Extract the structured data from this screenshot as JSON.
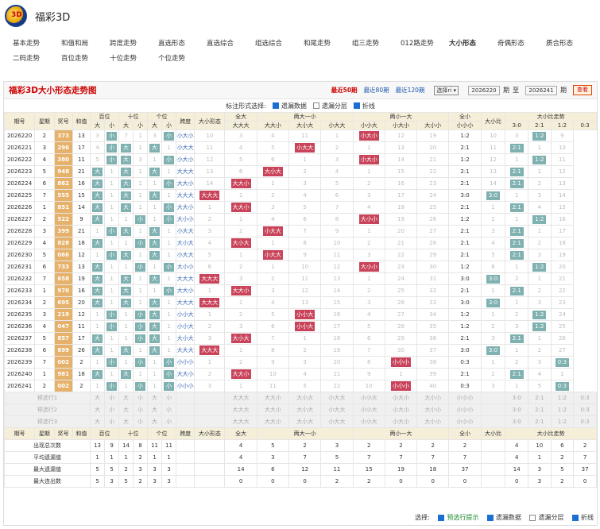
{
  "site": {
    "title": "福彩3D"
  },
  "nav": [
    "基本走势",
    "和值和局",
    "跨度走势",
    "直选形态",
    "直选综合",
    "组选综合",
    "和尾走势",
    "组三走势",
    "012路走势",
    "大小形态",
    "奇偶形态",
    "质合形态",
    "二码走势",
    "百位走势",
    "十位走势",
    "个位走势"
  ],
  "panel": {
    "title": "福彩3D大小形态走势图",
    "recent50": "最近50期",
    "recent80": "最近80期",
    "recent120": "最近120期",
    "select": "选择ri",
    "from": "2026220",
    "to_label": "至",
    "to": "2026241",
    "period": "期",
    "query": "查看"
  },
  "options": {
    "label": "标注形式选择:",
    "o1": "遗漏数据",
    "o2": "遗漏分层",
    "o3": "折线"
  },
  "head1": [
    "期号",
    "星期",
    "奖号",
    "和值",
    "百位",
    "十位",
    "个位",
    "跨度",
    "大小形态",
    "全大",
    "两大一小",
    "两小一大",
    "全小",
    "大小比",
    "大小比走势"
  ],
  "head2": [
    "大",
    "小",
    "大",
    "小",
    "大",
    "小",
    "大大大",
    "大大小",
    "大小大",
    "小大大",
    "小小大",
    "小大小",
    "大小小",
    "小小小",
    "3:0",
    "2:1",
    "1:2",
    "0:3"
  ],
  "rows": [
    [
      "2026220",
      "2",
      "373",
      "13",
      "3",
      "小",
      "7",
      "1",
      "3",
      "小",
      "小大小",
      "10",
      "3",
      "4",
      "11",
      "1",
      "小大小",
      "12",
      "19",
      "1:2",
      "10",
      "3",
      "1:2",
      "9"
    ],
    [
      "2026221",
      "3",
      "296",
      "17",
      "4",
      "小",
      "大",
      "1",
      "大",
      "1",
      "小大大",
      "11",
      "4",
      "5",
      "小大大",
      "2",
      "1",
      "13",
      "20",
      "2:1",
      "11",
      "2:1",
      "1",
      "10"
    ],
    [
      "2026222",
      "4",
      "380",
      "11",
      "5",
      "小",
      "大",
      "3",
      "1",
      "小",
      "小大小",
      "12",
      "5",
      "6",
      "1",
      "3",
      "小大小",
      "14",
      "21",
      "1:2",
      "12",
      "1",
      "1:2",
      "11"
    ],
    [
      "2026223",
      "5",
      "948",
      "21",
      "大",
      "1",
      "大",
      "1",
      "大",
      "1",
      "大大大",
      "13",
      "6",
      "大小大",
      "2",
      "4",
      "1",
      "15",
      "22",
      "2:1",
      "13",
      "2:1",
      "1",
      "12"
    ],
    [
      "2026224",
      "6",
      "862",
      "16",
      "大",
      "1",
      "大",
      "1",
      "1",
      "小",
      "大大小",
      "14",
      "大大小",
      "1",
      "3",
      "5",
      "2",
      "16",
      "23",
      "2:1",
      "14",
      "2:1",
      "2",
      "13"
    ],
    [
      "2026225",
      "7",
      "555",
      "15",
      "大",
      "1",
      "大",
      "1",
      "大",
      "1",
      "大大大",
      "大大大",
      "1",
      "2",
      "4",
      "6",
      "3",
      "17",
      "24",
      "3:0",
      "3:0",
      "1",
      "3",
      "14"
    ],
    [
      "2026226",
      "1",
      "851",
      "14",
      "大",
      "1",
      "大",
      "1",
      "1",
      "小",
      "大大小",
      "1",
      "大大小",
      "3",
      "5",
      "7",
      "4",
      "18",
      "25",
      "2:1",
      "1",
      "2:1",
      "4",
      "15"
    ],
    [
      "2026227",
      "2",
      "522",
      "9",
      "大",
      "1",
      "1",
      "小",
      "1",
      "小",
      "大小小",
      "2",
      "1",
      "4",
      "6",
      "8",
      "大小小",
      "19",
      "26",
      "1:2",
      "2",
      "1",
      "1:2",
      "16"
    ],
    [
      "2026228",
      "3",
      "399",
      "21",
      "1",
      "小",
      "大",
      "1",
      "大",
      "1",
      "小大大",
      "3",
      "2",
      "小大大",
      "7",
      "9",
      "1",
      "20",
      "27",
      "2:1",
      "3",
      "2:1",
      "1",
      "17"
    ],
    [
      "2026229",
      "4",
      "828",
      "18",
      "大",
      "1",
      "1",
      "小",
      "大",
      "1",
      "大小大",
      "4",
      "大小大",
      "1",
      "8",
      "10",
      "2",
      "21",
      "28",
      "2:1",
      "4",
      "2:1",
      "2",
      "18"
    ],
    [
      "2026230",
      "5",
      "066",
      "12",
      "1",
      "小",
      "大",
      "1",
      "大",
      "1",
      "小大大",
      "5",
      "1",
      "小大大",
      "9",
      "11",
      "3",
      "22",
      "29",
      "2:1",
      "5",
      "2:1",
      "3",
      "19"
    ],
    [
      "2026231",
      "6",
      "733",
      "13",
      "大",
      "1",
      "1",
      "小",
      "1",
      "小",
      "大小小",
      "6",
      "2",
      "1",
      "10",
      "12",
      "大小小",
      "23",
      "30",
      "1:2",
      "6",
      "1",
      "1:2",
      "20"
    ],
    [
      "2026232",
      "7",
      "658",
      "19",
      "大",
      "1",
      "大",
      "1",
      "大",
      "1",
      "大大大",
      "大大大",
      "3",
      "2",
      "11",
      "13",
      "1",
      "24",
      "31",
      "3:0",
      "3:0",
      "2",
      "1",
      "21"
    ],
    [
      "2026233",
      "1",
      "970",
      "16",
      "大",
      "1",
      "大",
      "1",
      "1",
      "小",
      "大大小",
      "1",
      "大大小",
      "3",
      "12",
      "14",
      "2",
      "25",
      "32",
      "2:1",
      "1",
      "2:1",
      "2",
      "22"
    ],
    [
      "2026234",
      "2",
      "695",
      "20",
      "大",
      "1",
      "大",
      "1",
      "大",
      "1",
      "大大大",
      "大大大",
      "1",
      "4",
      "13",
      "15",
      "3",
      "26",
      "33",
      "3:0",
      "3:0",
      "1",
      "3",
      "23"
    ],
    [
      "2026235",
      "3",
      "219",
      "12",
      "1",
      "小",
      "1",
      "小",
      "大",
      "1",
      "小小大",
      "1",
      "2",
      "5",
      "小小大",
      "16",
      "4",
      "27",
      "34",
      "1:2",
      "1",
      "2",
      "1:2",
      "24"
    ],
    [
      "2026236",
      "4",
      "047",
      "11",
      "1",
      "小",
      "1",
      "小",
      "大",
      "1",
      "小小大",
      "2",
      "3",
      "6",
      "小小大",
      "17",
      "5",
      "28",
      "35",
      "1:2",
      "2",
      "3",
      "1:2",
      "25"
    ],
    [
      "2026237",
      "5",
      "857",
      "17",
      "大",
      "1",
      "1",
      "小",
      "大",
      "1",
      "大小大",
      "3",
      "大小大",
      "7",
      "1",
      "18",
      "6",
      "29",
      "36",
      "2:1",
      "3",
      "2:1",
      "1",
      "26"
    ],
    [
      "2026238",
      "6",
      "899",
      "26",
      "大",
      "1",
      "大",
      "1",
      "大",
      "1",
      "大大大",
      "大大大",
      "1",
      "8",
      "2",
      "19",
      "7",
      "30",
      "37",
      "3:0",
      "3:0",
      "1",
      "2",
      "27"
    ],
    [
      "2026239",
      "7",
      "002",
      "2",
      "1",
      "小",
      "1",
      "小",
      "1",
      "小",
      "小小小",
      "1",
      "2",
      "9",
      "3",
      "20",
      "8",
      "小小小",
      "38",
      "0:3",
      "1",
      "2",
      "3",
      "0:3"
    ],
    [
      "2026240",
      "1",
      "981",
      "18",
      "大",
      "1",
      "大",
      "1",
      "1",
      "小",
      "大大小",
      "2",
      "大大小",
      "10",
      "4",
      "21",
      "9",
      "1",
      "39",
      "2:1",
      "2",
      "2:1",
      "4",
      "1"
    ],
    [
      "2026241",
      "2",
      "002",
      "2",
      "1",
      "小",
      "1",
      "小",
      "1",
      "小",
      "小小小",
      "3",
      "1",
      "11",
      "5",
      "22",
      "10",
      "小小小",
      "40",
      "0:3",
      "3",
      "1",
      "5",
      "0:3"
    ]
  ],
  "pre": [
    "预选行1",
    "预选行2",
    "预选行3"
  ],
  "foot": [
    [
      "出现总次数",
      "13",
      "9",
      "14",
      "8",
      "11",
      "11",
      "",
      "4",
      "5",
      "2",
      "3",
      "2",
      "2",
      "2",
      "2",
      "",
      "4",
      "10",
      "6",
      "2"
    ],
    [
      "平均遗漏值",
      "1",
      "1",
      "1",
      "2",
      "1",
      "1",
      "",
      "4",
      "3",
      "7",
      "5",
      "7",
      "7",
      "7",
      "7",
      "",
      "4",
      "1",
      "2",
      "7"
    ],
    [
      "最大遗漏值",
      "5",
      "5",
      "2",
      "3",
      "3",
      "3",
      "",
      "14",
      "6",
      "12",
      "11",
      "15",
      "19",
      "18",
      "37",
      "",
      "14",
      "3",
      "5",
      "37"
    ],
    [
      "最大连出数",
      "5",
      "3",
      "5",
      "2",
      "3",
      "3",
      "",
      "0",
      "0",
      "0",
      "2",
      "2",
      "0",
      "0",
      "0",
      "",
      "0",
      "3",
      "2",
      "0"
    ]
  ],
  "bottom": {
    "label": "选择:",
    "o1": "预选行提示",
    "o2": "遗漏数据",
    "o3": "遗漏分层",
    "o4": "折线"
  }
}
